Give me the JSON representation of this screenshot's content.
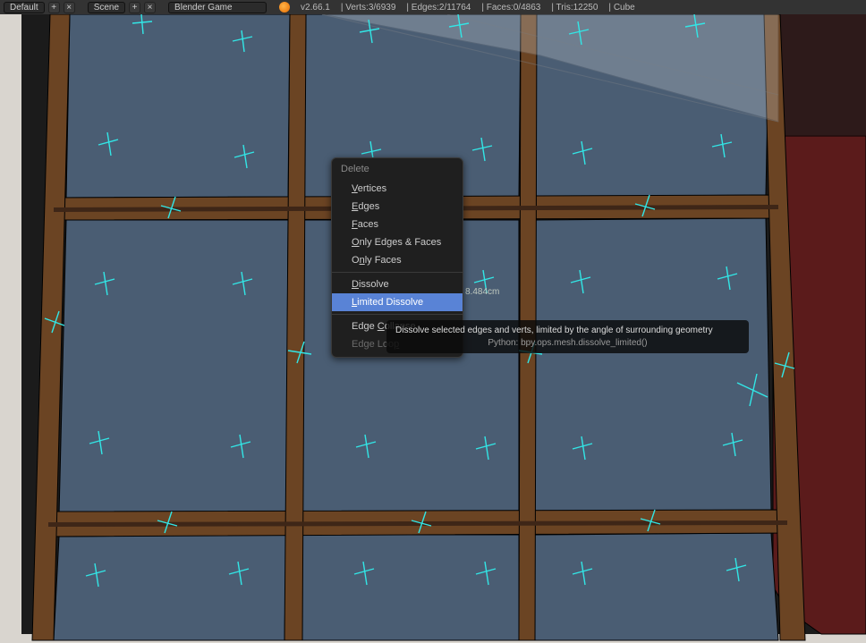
{
  "header": {
    "layout_label": "Default",
    "scene_label": "Scene",
    "engine_label": "Blender Game",
    "version": "v2.66.1",
    "verts": "Verts:3/6939",
    "edges": "Edges:2/11764",
    "faces": "Faces:0/4863",
    "tris": "Tris:12250",
    "object": "Cube",
    "plus": "+",
    "x": "×"
  },
  "viewport": {
    "overlay_coord": "8.484cm"
  },
  "menu": {
    "title": "Delete",
    "items": {
      "vertices_pre": "",
      "vertices_u": "V",
      "vertices_rest": "ertices",
      "edges_pre": "",
      "edges_u": "E",
      "edges_rest": "dges",
      "faces_pre": "",
      "faces_u": "F",
      "faces_rest": "aces",
      "only_ef_pre": "",
      "only_ef_u": "O",
      "only_ef_rest": "nly Edges & Faces",
      "only_f_pre": "O",
      "only_f_u": "n",
      "only_f_rest": "ly Faces",
      "dissolve_pre": "",
      "dissolve_u": "D",
      "dissolve_rest": "issolve",
      "limited_pre": "",
      "limited_u": "L",
      "limited_rest": "imited Dissolve",
      "edgec_pre": "Edge ",
      "edgec_u": "C",
      "edgec_rest": "ollapse",
      "edgel_pre": "Edge Loo",
      "edgel_u": "p",
      "edgel_rest": ""
    }
  },
  "tooltip": {
    "desc": "Dissolve selected edges and verts, limited by the angle of surrounding geometry",
    "python": "Python: bpy.ops.mesh.dissolve_limited()"
  },
  "colors": {
    "accent": "#5983d6",
    "glass": "#4a5d73",
    "frame_dark": "#3e2617",
    "frame_light": "#6b4423",
    "wall": "#5b1b1b",
    "outerwall": "#d9d5cf",
    "normal": "#32e6e6"
  }
}
